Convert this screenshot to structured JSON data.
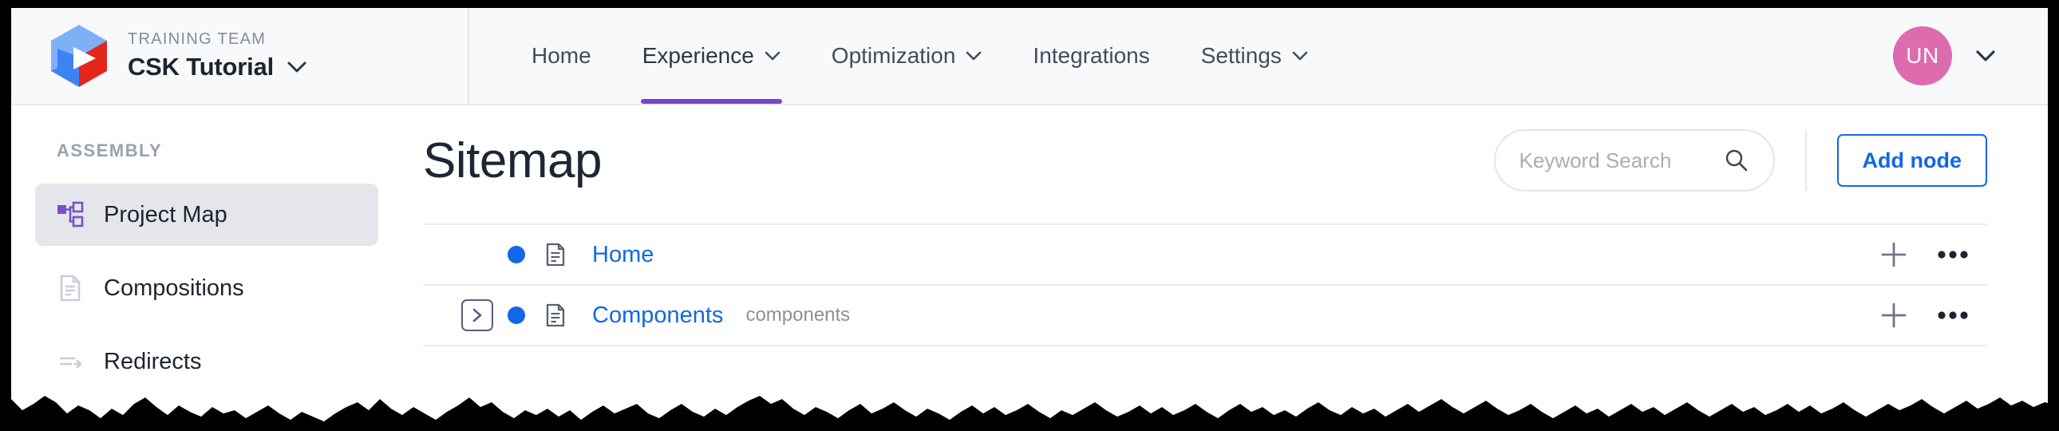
{
  "header": {
    "brand": {
      "eyebrow": "TRAINING TEAM",
      "name": "CSK Tutorial",
      "logo_icon": "cube-play-logo-icon",
      "dropdown_icon": "chevron-down-icon"
    },
    "nav": [
      {
        "label": "Home",
        "has_dropdown": false,
        "active": false
      },
      {
        "label": "Experience",
        "has_dropdown": true,
        "active": true
      },
      {
        "label": "Optimization",
        "has_dropdown": true,
        "active": false
      },
      {
        "label": "Integrations",
        "has_dropdown": false,
        "active": false
      },
      {
        "label": "Settings",
        "has_dropdown": true,
        "active": false
      }
    ],
    "user": {
      "initials": "UN",
      "avatar_color": "#DD6BAE",
      "dropdown_icon": "chevron-down-icon"
    },
    "active_underline_color": "#7349C8",
    "background_color": "#F8F9FB"
  },
  "sidebar": {
    "section_label": "ASSEMBLY",
    "items": [
      {
        "label": "Project Map",
        "icon": "sitemap-icon",
        "active": true
      },
      {
        "label": "Compositions",
        "icon": "document-icon",
        "active": false
      },
      {
        "label": "Redirects",
        "icon": "redirect-arrow-icon",
        "active": false
      }
    ],
    "active_background": "#E4E6EB",
    "active_icon_color": "#7A52C7"
  },
  "main": {
    "title": "Sitemap",
    "search": {
      "placeholder": "Keyword Search",
      "value": "",
      "icon": "search-icon"
    },
    "add_node_button": {
      "label": "Add node",
      "color": "#1267E8"
    },
    "tree": {
      "rows": [
        {
          "name": "Home",
          "slug": "",
          "depth": 0,
          "has_expander": false,
          "status_dot_color": "#1267E8",
          "page_icon": "document-icon",
          "actions": [
            "plus-icon",
            "more-options-icon"
          ]
        },
        {
          "name": "Components",
          "slug": "components",
          "depth": 0,
          "has_expander": true,
          "expander_icon": "chevron-right-icon",
          "status_dot_color": "#1267E8",
          "page_icon": "document-icon",
          "actions": [
            "plus-icon",
            "more-options-icon"
          ]
        }
      ]
    }
  }
}
